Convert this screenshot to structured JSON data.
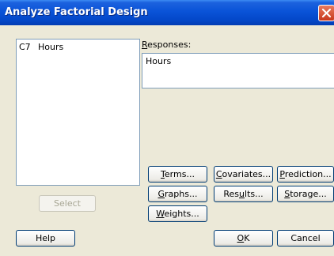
{
  "window": {
    "title": "Analyze Factorial Design"
  },
  "variables": [
    {
      "col": "C7",
      "name": "Hours"
    }
  ],
  "responses": {
    "label_pre": "",
    "label_ul": "R",
    "label_post": "esponses:",
    "value": "Hours"
  },
  "buttons": {
    "terms": {
      "pre": "",
      "ul": "T",
      "post": "erms..."
    },
    "covariates": {
      "pre": "",
      "ul": "C",
      "post": "ovariates..."
    },
    "prediction": {
      "pre": "",
      "ul": "P",
      "post": "rediction..."
    },
    "graphs": {
      "pre": "",
      "ul": "G",
      "post": "raphs..."
    },
    "results": {
      "pre": "Res",
      "ul": "u",
      "post": "lts..."
    },
    "storage": {
      "pre": "",
      "ul": "S",
      "post": "torage..."
    },
    "weights": {
      "pre": "",
      "ul": "W",
      "post": "eights..."
    },
    "select": "Select",
    "help": "Help",
    "ok": {
      "pre": "",
      "ul": "O",
      "post": "K"
    },
    "cancel": "Cancel"
  }
}
